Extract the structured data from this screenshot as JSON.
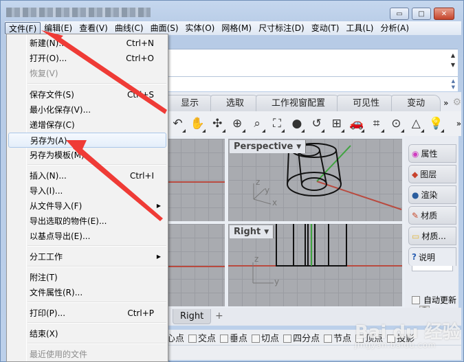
{
  "window": {
    "title_obscured": true,
    "controls": {
      "minimize": "▭",
      "maximize": "□",
      "close": "✕"
    }
  },
  "menubar": {
    "items": [
      {
        "label": "文件(F)",
        "active": true
      },
      {
        "label": "编辑(E)"
      },
      {
        "label": "查看(V)"
      },
      {
        "label": "曲线(C)"
      },
      {
        "label": "曲面(S)"
      },
      {
        "label": "实体(O)"
      },
      {
        "label": "网格(M)"
      },
      {
        "label": "尺寸标注(D)"
      },
      {
        "label": "变动(T)"
      },
      {
        "label": "工具(L)"
      },
      {
        "label": "分析(A)"
      }
    ]
  },
  "file_menu": {
    "items": [
      {
        "label": "新建(N)...",
        "shortcut": "Ctrl+N"
      },
      {
        "label": "打开(O)...",
        "shortcut": "Ctrl+O"
      },
      {
        "label": "恢复(V)",
        "disabled": true
      },
      {
        "label": "保存文件(S)",
        "shortcut": "Ctrl+S"
      },
      {
        "label": "最小化保存(V)..."
      },
      {
        "label": "递增保存(C)"
      },
      {
        "label": "另存为(A)",
        "highlighted": true
      },
      {
        "label": "另存为模板(M)..."
      },
      {
        "label": "插入(N)...",
        "shortcut": "Ctrl+I"
      },
      {
        "label": "导入(I)..."
      },
      {
        "label": "从文件导入(F)",
        "submenu": "▶"
      },
      {
        "label": "导出选取的物件(E)..."
      },
      {
        "label": "以基点导出(E)..."
      },
      {
        "label": "分工工作",
        "submenu": "▶"
      },
      {
        "label": "附注(T)"
      },
      {
        "label": "文件属性(R)..."
      },
      {
        "label": "打印(P)...",
        "shortcut": "Ctrl+P"
      },
      {
        "label": "结束(X)"
      },
      {
        "label": "最近使用的文件",
        "disabled": true
      }
    ]
  },
  "command": {
    "history_text": "",
    "input_value": ""
  },
  "toolbar_tabs": {
    "items": [
      "显示",
      "选取",
      "工作视窗配置",
      "可见性",
      "变动"
    ],
    "overflow": "»"
  },
  "toolbar": {
    "tools": [
      {
        "icon": "rotate-view-icon",
        "glyph": "↶"
      },
      {
        "icon": "pan-hand-icon",
        "glyph": "✋"
      },
      {
        "icon": "orbit-icon",
        "glyph": "✣"
      },
      {
        "icon": "zoom-dynamic-icon",
        "glyph": "⊕"
      },
      {
        "icon": "zoom-window-icon",
        "glyph": "⌕"
      },
      {
        "icon": "zoom-extents-icon",
        "glyph": "⛶"
      },
      {
        "icon": "zoom-selected-icon",
        "glyph": "●"
      },
      {
        "icon": "undo-view-icon",
        "glyph": "↺"
      },
      {
        "icon": "four-viewports-icon",
        "glyph": "⊞"
      },
      {
        "icon": "car-render-icon",
        "glyph": "🚗"
      },
      {
        "icon": "cplane-icon",
        "glyph": "⌗"
      },
      {
        "icon": "set-view-icon",
        "glyph": "⊙"
      },
      {
        "icon": "shapes-icon",
        "glyph": "△"
      },
      {
        "icon": "light-bulb-icon",
        "glyph": "💡"
      }
    ],
    "overflow": "»"
  },
  "viewports": {
    "perspective": {
      "label": "Perspective",
      "axes": [
        "z",
        "y",
        "x"
      ]
    },
    "right": {
      "label": "Right",
      "axes": [
        "z",
        "y"
      ]
    }
  },
  "side_panel": {
    "tabs": [
      {
        "label": "属性",
        "icon": "color-wheel-icon"
      },
      {
        "label": "图层",
        "icon": "layers-icon"
      },
      {
        "label": "渲染",
        "icon": "render-teapot-icon"
      },
      {
        "label": "材质",
        "icon": "material-brush-icon"
      },
      {
        "label": "材质...",
        "icon": "folder-icon"
      },
      {
        "label": "说明",
        "icon": "help-icon"
      }
    ],
    "auto_update_label": "自动更新",
    "auto_update_checked": false
  },
  "view_tabs": {
    "items": [
      "Right"
    ],
    "add_label": "+"
  },
  "osnap": {
    "items": [
      "中心点",
      "交点",
      "垂点",
      "切点",
      "四分点",
      "节点",
      "顶点",
      "投影"
    ]
  },
  "watermark": {
    "brand": "Bai du 经验",
    "url": "jingyan.baidu.com"
  },
  "colors": {
    "annotation_arrow": "#ef3b36",
    "x_axis": "#c0392b",
    "y_axis": "#3fa33f",
    "menu_highlight": "#e4eefa"
  }
}
